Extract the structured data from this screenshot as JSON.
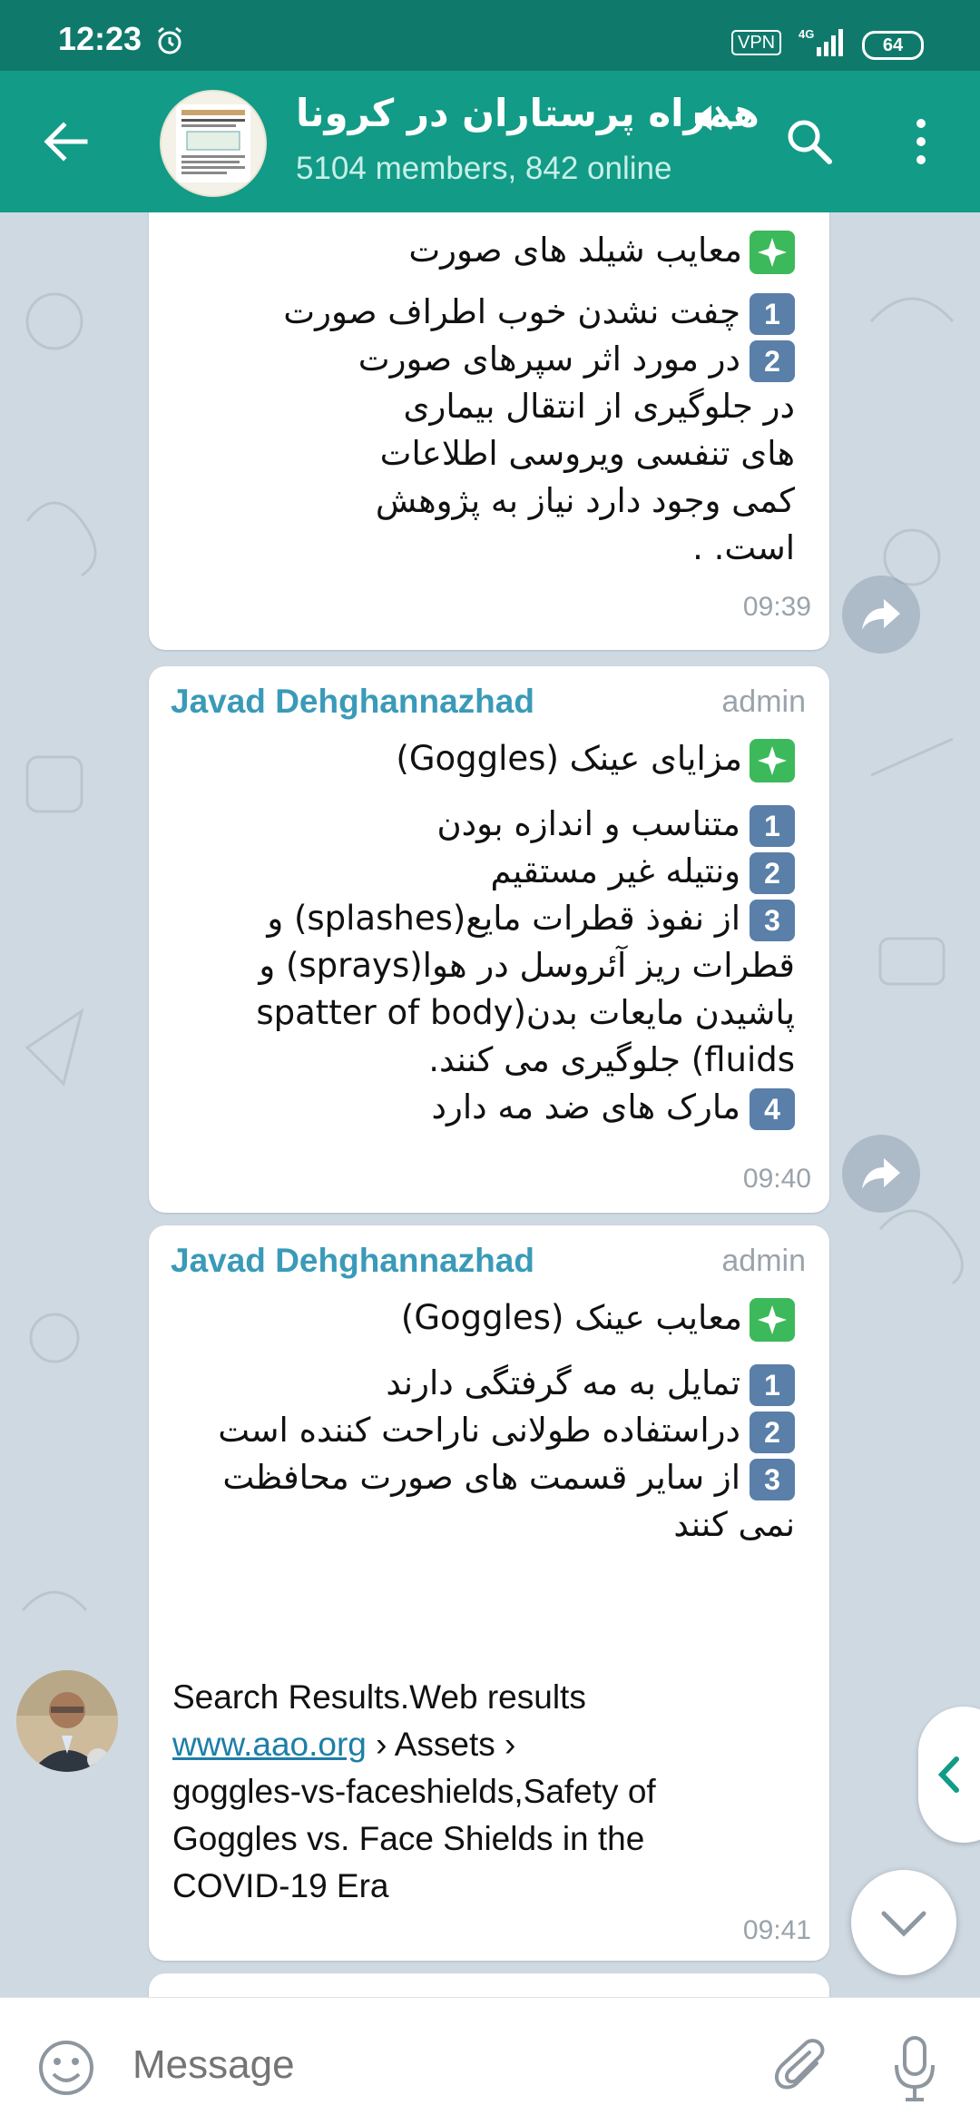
{
  "status_bar": {
    "time": "12:23",
    "vpn": "VPN",
    "network": "4G",
    "battery": "64"
  },
  "header": {
    "title": "همراه پرستاران در کرونا",
    "subtitle": "5104 members, 842 online"
  },
  "messages": [
    {
      "heading": "معایب شیلد های صورت",
      "lines": [
        {
          "num": "1",
          "text": "چفت نشدن خوب اطراف صورت"
        },
        {
          "num": "2",
          "text": "در مورد اثر سپرهای صورت"
        },
        {
          "num": "",
          "text": "در جلوگیری از انتقال بیماری"
        },
        {
          "num": "",
          "text": "های تنفسی ویروسی اطلاعات"
        },
        {
          "num": "",
          "text": "کمی وجود دارد نیاز به پژوهش"
        },
        {
          "num": "",
          "text": "است.                ."
        }
      ],
      "time": "09:39"
    },
    {
      "sender": "Javad Dehghannazhad",
      "tag": "admin",
      "heading": "مزایای عینک (Goggles)",
      "lines": [
        {
          "num": "1",
          "text": "متناسب و اندازه بودن"
        },
        {
          "num": "2",
          "text": "ونتیله غیر مستقیم"
        },
        {
          "num": "3",
          "text": "از نفوذ قطرات مایع(splashes) و"
        },
        {
          "num": "",
          "text": "قطرات ریز آئروسل در هوا(sprays) و"
        },
        {
          "num": "",
          "text": "پاشیدن مایعات بدن(spatter of body"
        },
        {
          "num": "",
          "text": "fluids) جلوگیری می کنند."
        },
        {
          "num": "4",
          "text": "مارک های ضد مه دارد"
        }
      ],
      "time": "09:40"
    },
    {
      "sender": "Javad Dehghannazhad",
      "tag": "admin",
      "heading": "معایب عینک (Goggles)",
      "lines": [
        {
          "num": "1",
          "text": "تمایل به مه گرفتگی دارند"
        },
        {
          "num": "2",
          "text": "دراستفاده طولانی ناراحت کننده است"
        },
        {
          "num": "3",
          "text": "از سایر قسمت های صورت محافظت"
        },
        {
          "num": "",
          "text": "نمی کنند"
        }
      ],
      "ltr_lines": [
        "Search Results.Web results",
        "› Assets ›",
        "goggles-vs-faceshields,Safety of",
        "Goggles vs. Face Shields in the",
        "COVID-19 Era"
      ],
      "link_text": "www.aao.org",
      "time": "09:41"
    }
  ],
  "input": {
    "placeholder": "Message"
  },
  "colors": {
    "header": "#129b86",
    "status_bar": "#0f7a6c",
    "sender": "#3a9ab8",
    "link": "#1d7ea8",
    "number_keycap": "#5a7fa8",
    "sparkle": "#3cb95a"
  }
}
